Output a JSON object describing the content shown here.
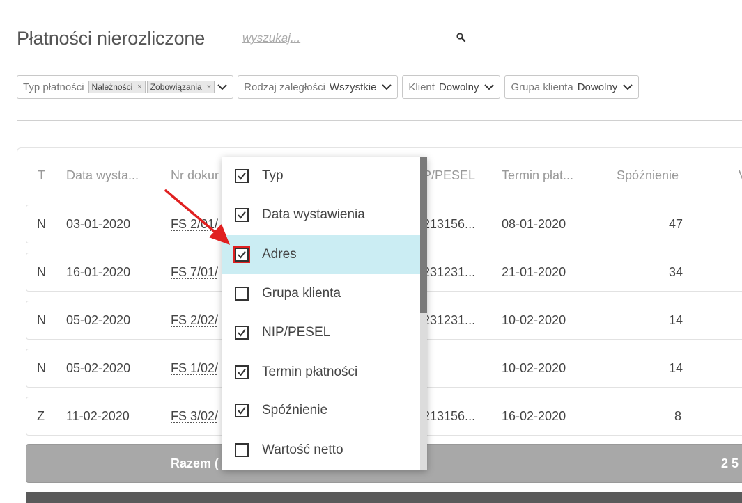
{
  "page": {
    "title": "Płatności nierozliczone"
  },
  "search": {
    "placeholder": "wyszukaj..."
  },
  "filters": {
    "payment_type": {
      "label": "Typ płatności",
      "chips": [
        "Należności",
        "Zobowiązania"
      ]
    },
    "overdue_type": {
      "label": "Rodzaj zaległości",
      "value": "Wszystkie"
    },
    "client": {
      "label": "Klient",
      "value": "Dowolny"
    },
    "client_group": {
      "label": "Grupa klienta",
      "value": "Dowolny"
    }
  },
  "table": {
    "headers": [
      "T",
      "Data wysta...",
      "Nr dokur",
      "P/PESEL",
      "Termin płat...",
      "Spóźnienie",
      "V"
    ],
    "rows": [
      {
        "t": "N",
        "date": "03-01-2020",
        "doc": "FS 2/01/",
        "nip": "213156...",
        "due": "08-01-2020",
        "late": "47"
      },
      {
        "t": "N",
        "date": "16-01-2020",
        "doc": "FS 7/01/",
        "nip": "231231...",
        "due": "21-01-2020",
        "late": "34"
      },
      {
        "t": "N",
        "date": "05-02-2020",
        "doc": "FS 2/02/",
        "nip": "231231...",
        "due": "10-02-2020",
        "late": "14"
      },
      {
        "t": "N",
        "date": "05-02-2020",
        "doc": "FS 1/02/",
        "nip": "",
        "due": "10-02-2020",
        "late": "14"
      },
      {
        "t": "Z",
        "date": "11-02-2020",
        "doc": "FS 3/02/",
        "nip": "213156...",
        "due": "16-02-2020",
        "late": "8"
      }
    ],
    "total_label": "Razem (",
    "total_value": "2 5"
  },
  "column_menu": {
    "items": [
      {
        "label": "Typ",
        "checked": true
      },
      {
        "label": "Data wystawienia",
        "checked": true
      },
      {
        "label": "Adres",
        "checked": true,
        "highlighted": true
      },
      {
        "label": "Grupa klienta",
        "checked": false
      },
      {
        "label": "NIP/PESEL",
        "checked": true
      },
      {
        "label": "Termin płatności",
        "checked": true
      },
      {
        "label": "Spóźnienie",
        "checked": true
      },
      {
        "label": "Wartość netto",
        "checked": false
      }
    ]
  },
  "colors": {
    "highlight": "#cbedf3",
    "annotation_arrow": "#e02020",
    "total_row": "#a8a8a8"
  }
}
